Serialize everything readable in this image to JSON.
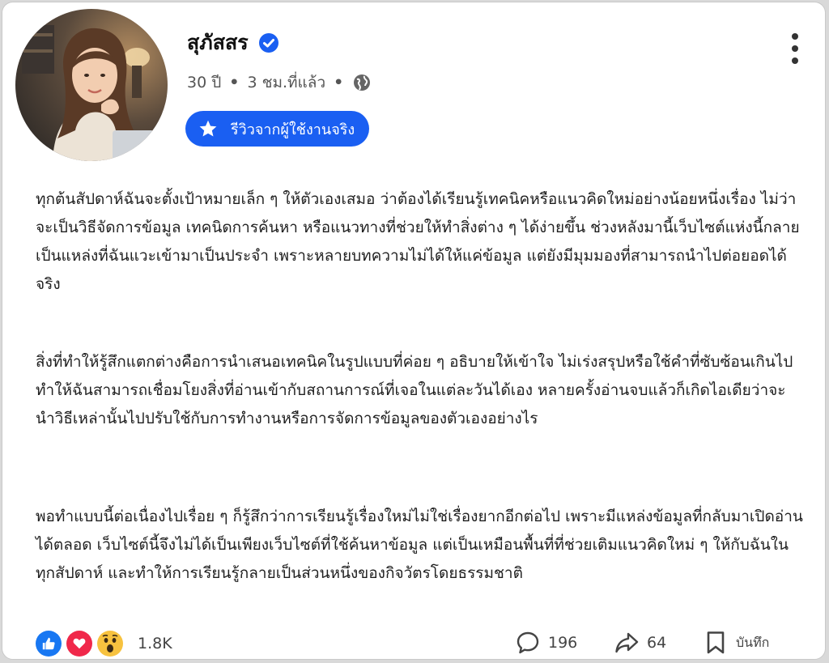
{
  "post": {
    "author": {
      "name": "สุภัสสร",
      "verified": true
    },
    "meta": {
      "age": "30 ปี",
      "time": "3 ชม.ที่แล้ว",
      "separator": "•",
      "privacy_icon": "globe-icon"
    },
    "badge": {
      "icon": "star-icon",
      "label": "รีวิวจากผู้ใช้งานจริง"
    },
    "menu_icon": "more-vertical-icon",
    "paragraphs": [
      "ทุกต้นสัปดาห์ฉันจะตั้งเป้าหมายเล็ก ๆ ให้ตัวเองเสมอ ว่าต้องได้เรียนรู้เทคนิคหรือแนวคิดใหม่อย่างน้อยหนึ่งเรื่อง ไม่ว่าจะเป็นวิธีจัดการข้อมูล เทคนิดการค้นหา หรือแนวทางที่ช่วยให้ทำสิ่งต่าง ๆ ได้ง่ายขึ้น ช่วงหลังมานี้เว็บไซต์แห่งนี้กลายเป็นแหล่งที่ฉันแวะเข้ามาเป็นประจำ เพราะหลายบทความไม่ได้ให้แค่ข้อมูล แต่ยังมีมุมมองที่สามารถนำไปต่อยอดได้จริง",
      "สิ่งที่ทำให้รู้สึกแตกต่างคือการนำเสนอเทคนิคในรูปแบบที่ค่อย ๆ อธิบายให้เข้าใจ ไม่เร่งสรุปหรือใช้คำที่ซับซ้อนเกินไป ทำให้ฉันสามารถเชื่อมโยงสิ่งที่อ่านเข้ากับสถานการณ์ที่เจอในแต่ละวันได้เอง หลายครั้งอ่านจบแล้วก็เกิดไอเดียว่าจะนำวิธีเหล่านั้นไปปรับใช้กับการทำงานหรือการจัดการข้อมูลของตัวเองอย่างไร",
      "พอทำแบบนี้ต่อเนื่องไปเรื่อย ๆ ก็รู้สึกว่าการเรียนรู้เรื่องใหม่ไม่ใช่เรื่องยากอีกต่อไป เพราะมีแหล่งข้อมูลที่กลับมาเปิดอ่านได้ตลอด เว็บไซต์นี้จึงไม่ได้เป็นเพียงเว็บไซต์ที่ใช้ค้นหาข้อมูล แต่เป็นเหมือนพื้นที่ที่ช่วยเติมแนวคิดใหม่ ๆ ให้กับฉันในทุกสัปดาห์ และทำให้การเรียนรู้กลายเป็นส่วนหนึ่งของกิจวัตรโดยธรรมชาติ"
    ],
    "reactions": {
      "icons": [
        "like-icon",
        "love-icon",
        "wow-icon"
      ],
      "count": "1.8K"
    },
    "comments": {
      "icon": "comment-icon",
      "count": "196"
    },
    "shares": {
      "icon": "share-icon",
      "count": "64"
    },
    "save": {
      "icon": "bookmark-icon",
      "label": "บันทึก"
    }
  },
  "colors": {
    "accent": "#1a5ff2",
    "like": "#1877f2",
    "love": "#f0284a",
    "wow": "#f7c23f"
  }
}
